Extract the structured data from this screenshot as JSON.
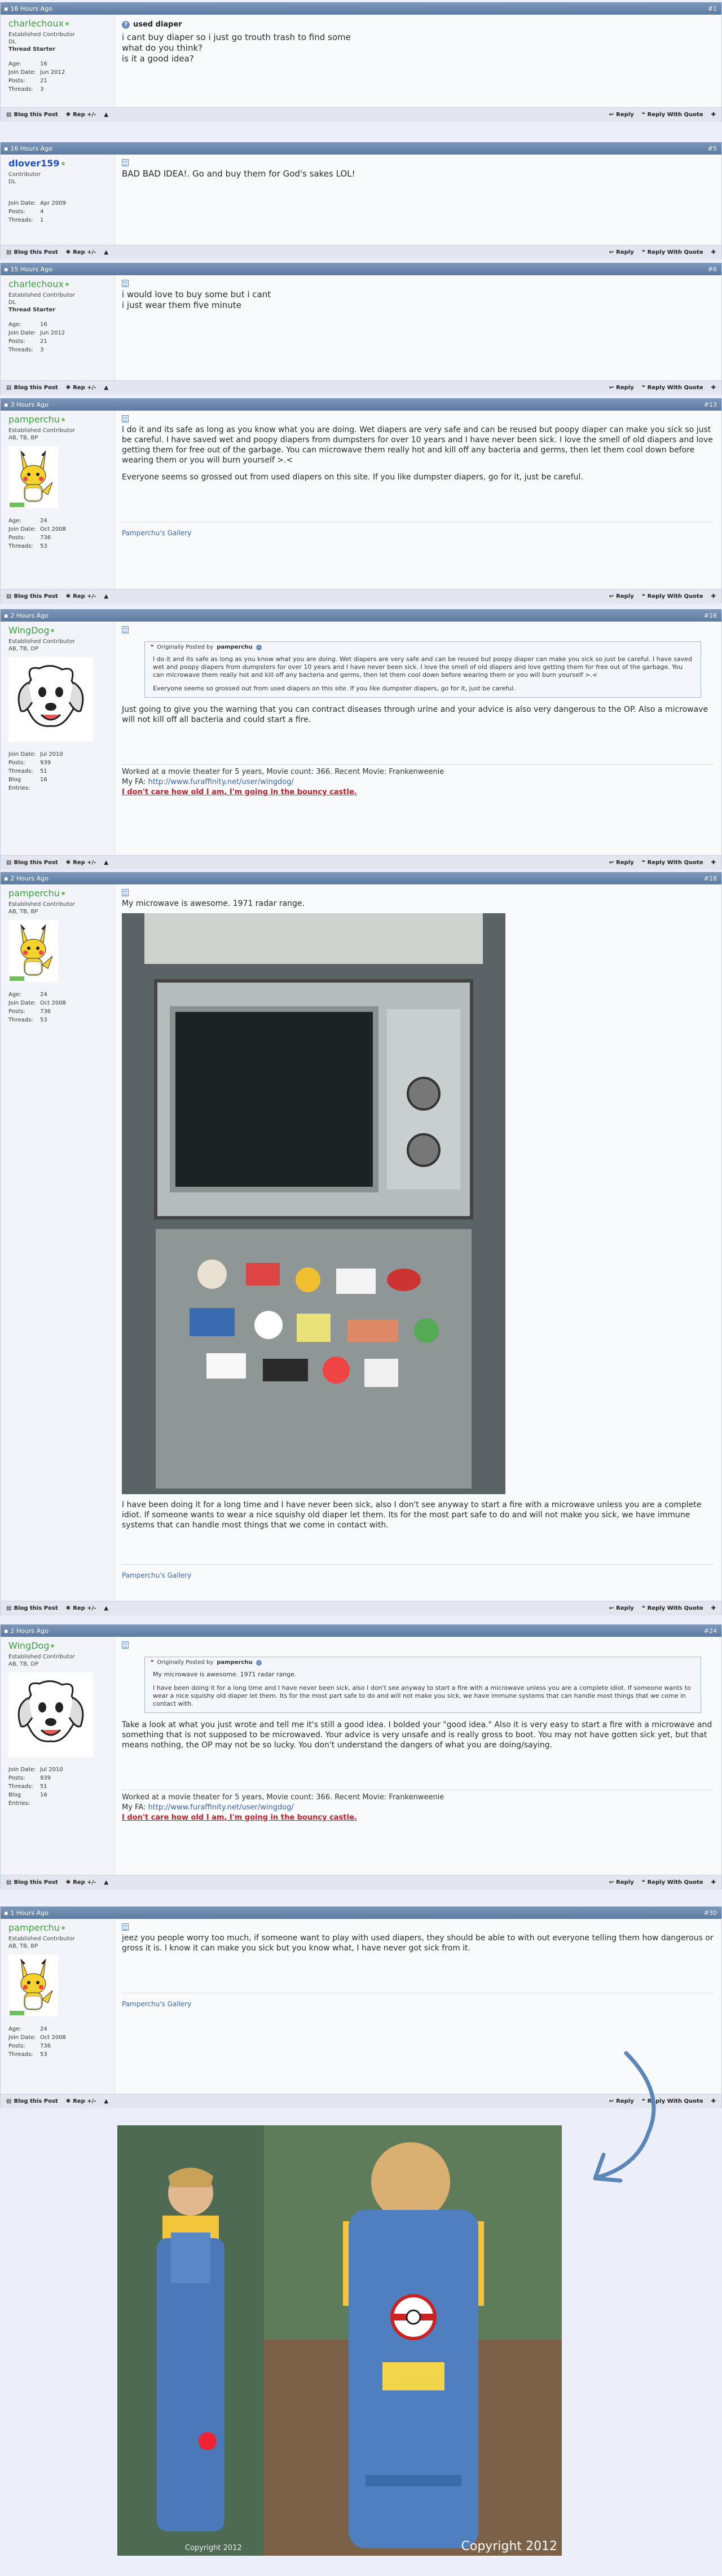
{
  "posts": [
    {
      "time": "16 Hours Ago",
      "num": "#1",
      "user": {
        "name": "charlechoux",
        "title": "Established Contributor",
        "subtitle": "DL",
        "extra": "Thread Starter",
        "age": "16",
        "join": "Jun 2012",
        "posts": "21",
        "threads": "3"
      },
      "title": "used diaper",
      "lines": [
        "i cant buy diaper so i just go trouth trash to find some",
        "what do you think?",
        "is it a good idea?"
      ]
    },
    {
      "time": "16 Hours Ago",
      "num": "#5",
      "user": {
        "name": "dlover159",
        "title": "Contributor",
        "subtitle": "DL",
        "join": "Apr 2009",
        "posts": "4",
        "threads": "1"
      },
      "lines": [
        "BAD BAD IDEA!. Go and buy them for God's sakes LOL!"
      ]
    },
    {
      "time": "15 Hours Ago",
      "num": "#6",
      "user": {
        "name": "charlechoux",
        "title": "Established Contributor",
        "subtitle": "DL",
        "extra": "Thread Starter",
        "age": "16",
        "join": "Jun 2012",
        "posts": "21",
        "threads": "3"
      },
      "lines": [
        "i would love to buy some but i cant",
        "i just wear them five minute"
      ]
    },
    {
      "time": "3 Hours Ago",
      "num": "#13",
      "user": {
        "name": "pamperchu",
        "title": "AB, TB, BP",
        "age": "24",
        "join": "Oct 2008",
        "posts": "736",
        "threads": "53"
      },
      "text": "I do it and its safe as long as you know what you are doing. Wet diapers are very safe and can be reused but poopy diaper can make you sick so just be careful. I have saved wet and poopy diapers from dumpsters for over 10 years and I have never been sick. I love the smell of old diapers and love getting them for free out of the garbage. You can microwave them really hot and kill off any bacteria and germs, then let them cool down before wearing them or you will burn yourself >.<",
      "text2": "Everyone seems so grossed out from used diapers on this site. If you like dumpster diapers, go for it, just be careful.",
      "gallery": "Pamperchu's Gallery"
    },
    {
      "time": "2 Hours Ago",
      "num": "#16",
      "user": {
        "name": "WingDog",
        "title": "Established Contributor",
        "subtitle": "AB, TB, DP",
        "join": "Jul 2010",
        "posts": "939",
        "threads": "51",
        "blog": "16"
      },
      "quote_by": "pamperchu",
      "quote": "I do it and its safe as long as you know what you are doing. Wet diapers are very safe and can be reused but poopy diaper can make you sick so just be careful. I have saved wet and poopy diapers from dumpsters for over 10 years and I have never been sick. I love the smell of old diapers and love getting them for free out of the garbage. You can microwave them really hot and kill off any bacteria and germs, then let them cool down before wearing them or you will burn yourself >.<",
      "quote2": "Everyone seems so grossed out from used diapers on this site. If you like dumpster diapers, go for it, just be careful.",
      "text": "Just going to give you the warning that you can contract diseases through urine and your advice is also very dangerous to the OP. Also a microwave will not kill off all bacteria and could start a fire.",
      "sig1": "Worked at a movie theater for 5 years, Movie count: 366. Recent Movie: Frankenweenie",
      "sig2_label": "My FA:",
      "sig2": "http://www.furaffinity.net/user/wingdog/",
      "sig3": "I don't care how old I am, I'm going in the bouncy castle."
    },
    {
      "time": "2 Hours Ago",
      "num": "#18",
      "user": {
        "name": "pamperchu",
        "title": "AB, TB, BP",
        "age": "24",
        "join": "Oct 2008",
        "posts": "736",
        "threads": "53"
      },
      "title": "My microwave is awesome. 1971 radar range.",
      "text": "I have been doing it for a long time and I have never been sick, also I don't see anyway to start a fire with a microwave unless you are a complete idiot. If someone wants to wear a nice squishy old diaper let them. Its for the most part safe to do and will not make you sick, we have immune systems that can handle most things that we come in contact with.",
      "gallery": "Pamperchu's Gallery"
    },
    {
      "time": "2 Hours Ago",
      "num": "#24",
      "user": {
        "name": "WingDog",
        "title": "Established Contributor",
        "subtitle": "AB, TB, DP",
        "join": "Jul 2010",
        "posts": "939",
        "threads": "51",
        "blog": "16"
      },
      "quote_by": "pamperchu",
      "quote": "My microwave is awesome. 1971 radar range.",
      "quote2": "I have been doing it for a long time and I have never been sick, also I don't see anyway to start a fire with a microwave unless you are a complete idiot. If someone wants to wear a nice squishy old diaper let them. Its for the most part safe to do and will not make you sick, we have immune systems that can handle most things that we come in contact with.",
      "text": "Take a look at what you just wrote and tell me it's still a good idea. I bolded your \"good idea.\" Also it is very easy to start a fire with a microwave and something that is not supposed to be microwaved. Your advice is very unsafe and is really gross to boot. You may not have gotten sick yet, but that means nothing, the OP may not be so lucky. You don't understand the dangers of what you are doing/saying.",
      "sig1": "Worked at a movie theater for 5 years, Movie count: 366. Recent Movie: Frankenweenie",
      "sig2_label": "My FA:",
      "sig2": "http://www.furaffinity.net/user/wingdog/",
      "sig3": "I don't care how old I am, I'm going in the bouncy castle."
    },
    {
      "time": "1 Hours Ago",
      "num": "#30",
      "user": {
        "name": "pamperchu",
        "title": "AB, TB, BP",
        "age": "24",
        "join": "Oct 2008",
        "posts": "736",
        "threads": "53"
      },
      "text": "jeez you people worry too much, if someone want to play with used diapers, they should be able to with out everyone telling them how dangerous or gross it is. I know it can make you sick but you know what, I have never got sick from it.",
      "gallery": "Pamperchu's Gallery"
    }
  ],
  "labels": {
    "age": "Age:",
    "join": "Join Date:",
    "posts": "Posts:",
    "threads": "Threads:",
    "blog": "Blog Entries:",
    "blog_post": "Blog this Post",
    "rep": "Rep +/-",
    "reply": "Reply",
    "reply_quote": "Reply With Quote",
    "originally": "Originally Posted by"
  },
  "photo_caption": "Copyright 2012"
}
